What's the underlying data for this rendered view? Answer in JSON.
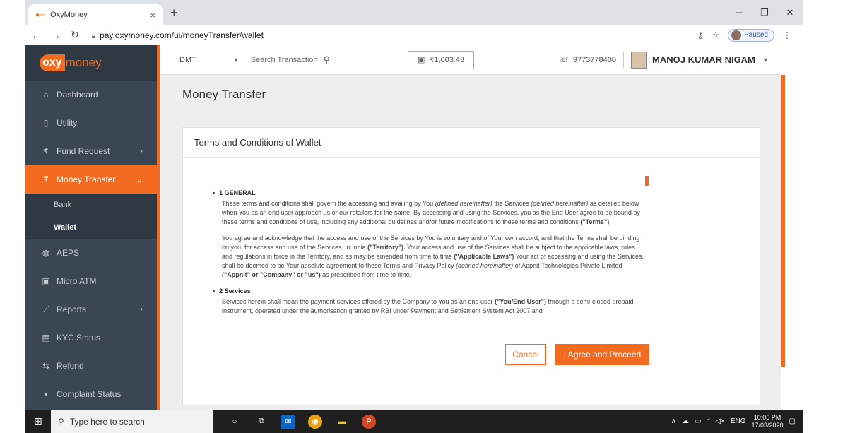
{
  "browser": {
    "tab_title": "OxyMoney",
    "tab_close": "×",
    "new_tab": "+",
    "url": "pay.oxymoney.com/ui/moneyTransfer/wallet",
    "profile_status": "Paused"
  },
  "logo": {
    "part1": "oxy",
    "part2": "money"
  },
  "sidebar": {
    "items": [
      {
        "label": "Dashboard",
        "icon": "home-icon"
      },
      {
        "label": "Utility",
        "icon": "mobile-icon"
      },
      {
        "label": "Fund Request",
        "icon": "rupee-icon"
      },
      {
        "label": "Money Transfer",
        "icon": "rupee-icon"
      },
      {
        "label": "AEPS",
        "icon": "fingerprint-icon"
      },
      {
        "label": "Micro ATM",
        "icon": "bank-icon"
      },
      {
        "label": "Reports",
        "icon": "chart-icon"
      },
      {
        "label": "KYC Status",
        "icon": "id-card-icon"
      },
      {
        "label": "Refund",
        "icon": "refund-icon"
      },
      {
        "label": "Complaint Status",
        "icon": "complaint-icon"
      }
    ],
    "sub_items": [
      "Bank",
      "Wallet"
    ]
  },
  "topbar": {
    "service": "DMT",
    "search_label": "Search Transaction",
    "balance": "₹1,003.43",
    "phone": "9773778400",
    "user_name": "MANOJ KUMAR NIGAM"
  },
  "page": {
    "title": "Money Transfer",
    "card_title": "Terms and Conditions of Wallet"
  },
  "terms": {
    "s1_heading": "1 GENERAL",
    "s1_p1_a": "These terms and conditions shall govern the accessing and availing by You ",
    "s1_p1_b": "(defined hereinafter)",
    "s1_p1_c": " the Services ",
    "s1_p1_d": "(defined hereinafter)",
    "s1_p1_e": " as detailed below when You as an end user approach us or our retailers for the same. By accessing and using the Services, you as the End User agree to be bound by these terms and conditions of use, including any additional guidelines and/or future modifications to these terms and conditions ",
    "s1_p1_f": "(\"Terms\").",
    "s1_p2_a": "You agree and acknowledge that the access and use of the Services by You is voluntary and of Your own accord, and that the Terms shall be binding on you, for access and use of the Services, in India ",
    "s1_p2_b": "(\"Territory\").",
    "s1_p2_c": " Your access and use of the Services shall be subject to the applicable laws, rules and regulations in force in the Territory, and as may be amended from time to time ",
    "s1_p2_d": "(\"Applicable Laws\")",
    "s1_p2_e": " Your act of accessing and using the Services, shall be deemed to be Your absolute agreement to these Terms and Privacy Policy ",
    "s1_p2_f": "(defined hereinafter)",
    "s1_p2_g": " of Appnit Technologies Private Limited ",
    "s1_p2_h": "(\"Appnit\" or \"Company\" or \"us\")",
    "s1_p2_i": " as prescribed from time to time.",
    "s2_heading": "2 Services",
    "s2_p1_a": "Services herein shall mean the payment services offered by the Company to You as an end user ",
    "s2_p1_b": "(\"You/End User\")",
    "s2_p1_c": " through a semi-closed prepaid instrument, operated under the authorisation granted by RBI under Payment and Settlement System Act 2007 and"
  },
  "buttons": {
    "cancel": "Cancel",
    "agree": "I Agree and Proceed"
  },
  "taskbar": {
    "search_placeholder": "Type here to search",
    "lang": "ENG",
    "time": "10:05 PM",
    "date": "17/03/2020"
  }
}
